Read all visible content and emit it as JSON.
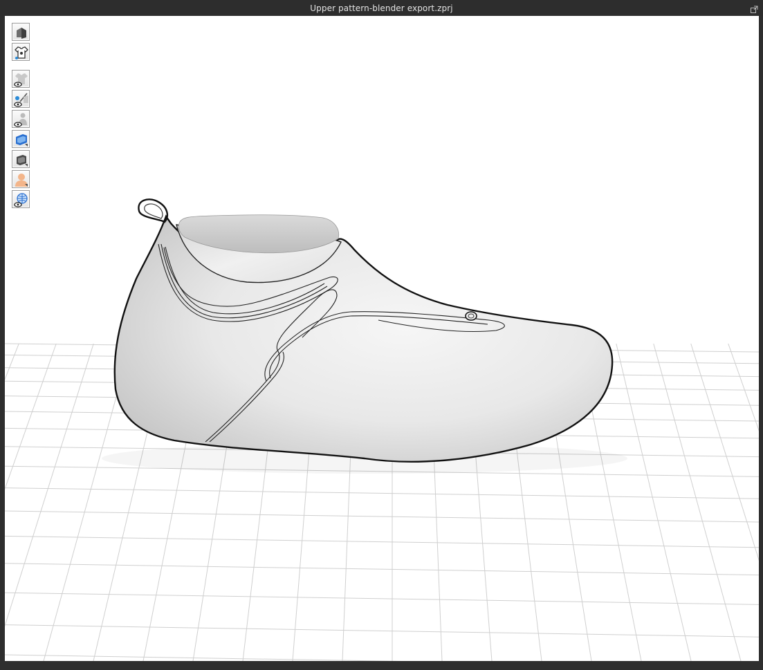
{
  "window": {
    "title": "Upper pattern-blender export.zprj"
  },
  "toolbar": {
    "tools": [
      {
        "name": "avatar-mode-icon"
      },
      {
        "name": "garment-mode-icon"
      },
      {
        "name": "show-garment-icon"
      },
      {
        "name": "show-pins-icon"
      },
      {
        "name": "show-avatar-icon"
      },
      {
        "name": "garment-render-style-icon"
      },
      {
        "name": "texture-surface-icon"
      },
      {
        "name": "avatar-skin-icon"
      },
      {
        "name": "show-environment-icon"
      }
    ]
  },
  "colors": {
    "title_bar": "#2d2d2d",
    "viewport_background": "#ffffff",
    "grid_line": "#cfcfcf"
  }
}
